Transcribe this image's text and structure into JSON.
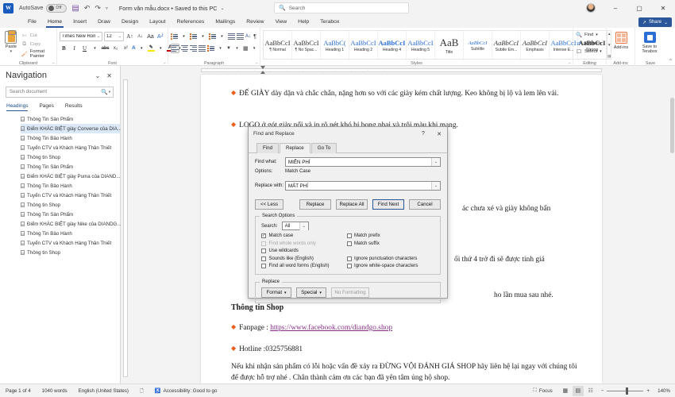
{
  "titlebar": {
    "app_icon": "word-logo",
    "autosave_label": "AutoSave",
    "autosave_state": "Off",
    "save_icon": "save-icon",
    "undo_icon": "undo-icon",
    "redo_icon": "redo-icon",
    "customize_icon": "customize-quick-access-icon",
    "document_title": "Form văn mẫu.docx  •  Saved to this PC",
    "title_caret": "⌄",
    "search_placeholder": "Search",
    "search_icon": "search-icon",
    "minimize": "–",
    "maximize": "▢",
    "close": "✕"
  },
  "tabs": [
    {
      "label": "File",
      "active": false
    },
    {
      "label": "Home",
      "active": true
    },
    {
      "label": "Insert",
      "active": false
    },
    {
      "label": "Draw",
      "active": false
    },
    {
      "label": "Design",
      "active": false
    },
    {
      "label": "Layout",
      "active": false
    },
    {
      "label": "References",
      "active": false
    },
    {
      "label": "Mailings",
      "active": false
    },
    {
      "label": "Review",
      "active": false
    },
    {
      "label": "View",
      "active": false
    },
    {
      "label": "Help",
      "active": false
    },
    {
      "label": "Terabox",
      "active": false
    }
  ],
  "share": {
    "label": "Share",
    "icon": "share-icon",
    "caret": "⌄"
  },
  "ribbon": {
    "clipboard": {
      "group_label": "Clipboard",
      "paste_label": "Paste",
      "paste_caret": "▾",
      "cut_label": "Cut",
      "copy_label": "Copy",
      "format_painter_label": "Format Painter",
      "launcher": "⌐"
    },
    "font": {
      "group_label": "Font",
      "font_name": "Times New Roman",
      "font_size": "12",
      "grow_font": "A",
      "shrink_font": "A",
      "change_case": "Aa",
      "clear_formatting": "A",
      "bold": "B",
      "italic": "I",
      "underline": "U",
      "strikethrough": "abc",
      "subscript": "x₂",
      "superscript": "x²",
      "text_color": "A",
      "highlight": "ab",
      "font_color_label": "A",
      "launcher": "⌐"
    },
    "paragraph": {
      "group_label": "Paragraph",
      "launcher": "⌐",
      "buttons": [
        "bullets",
        "numbering",
        "multilevel-list",
        "decrease-indent",
        "increase-indent",
        "sort",
        "show-marks",
        "align-left",
        "align-center",
        "align-right",
        "justify",
        "line-spacing",
        "shading",
        "borders"
      ]
    },
    "styles": {
      "group_label": "Styles",
      "launcher": "⌐",
      "items": [
        {
          "preview": "AaBbCcI",
          "name": "¶ Normal"
        },
        {
          "preview": "AaBbCcI",
          "name": "¶ No Spac..."
        },
        {
          "preview": "AaBbC(",
          "name": "Heading 1"
        },
        {
          "preview": "AaBbCcI",
          "name": "Heading 2"
        },
        {
          "preview": "AaBbCcI",
          "name": "Heading 4"
        },
        {
          "preview": "AaBbCcI",
          "name": "Heading 5"
        },
        {
          "preview": "AaB",
          "name": "Title"
        },
        {
          "preview": "AaBbCcI",
          "name": "Subtitle"
        },
        {
          "preview": "AaBbCcI",
          "name": "Subtle Em..."
        },
        {
          "preview": "AaBbCcI",
          "name": "Emphasis"
        },
        {
          "preview": "AaBbCcI",
          "name": "Intense E..."
        },
        {
          "preview": "AaBbCcI",
          "name": "Strong"
        }
      ]
    },
    "editing": {
      "group_label": "Editing",
      "find_label": "Find",
      "find_caret": "▾",
      "replace_label": "Replace",
      "select_label": "Select",
      "select_caret": "▾"
    },
    "addins": {
      "group_label": "Add-ins",
      "button_label": "Add-ins"
    },
    "save": {
      "group_label": "Save",
      "button_label": "Save to Terabox"
    },
    "collapse_icon": "chevron-up-icon"
  },
  "navigation": {
    "title": "Navigation",
    "collapse_icon": "chevron-down-icon",
    "close_icon": "close-icon",
    "search_placeholder": "Search document",
    "search_icon": "search-icon",
    "search_caret": "▾",
    "tabs": [
      {
        "label": "Headings",
        "active": true
      },
      {
        "label": "Pages",
        "active": false
      },
      {
        "label": "Results",
        "active": false
      }
    ],
    "headings": [
      {
        "label": "Thông Tin Sản Phẩm",
        "selected": false
      },
      {
        "label": "Điểm KHÁC BIỆT giày Converse của DIA...",
        "selected": true
      },
      {
        "label": "Thông Tin Bảo Hành",
        "selected": false
      },
      {
        "label": "Tuyển CTV và Khách Hàng Thân Thiết",
        "selected": false
      },
      {
        "label": "Thông tin Shop",
        "selected": false
      },
      {
        "label": "Thông Tin Sản Phẩm",
        "selected": false
      },
      {
        "label": "Điểm KHÁC BIỆT giày Puma của DIAND...",
        "selected": false
      },
      {
        "label": "Thông Tin Bảo Hành",
        "selected": false
      },
      {
        "label": "Tuyển CTV và Khách Hàng Thân Thiết",
        "selected": false
      },
      {
        "label": "Thông tin Shop",
        "selected": false
      },
      {
        "label": "Thông Tin Sản Phẩm",
        "selected": false
      },
      {
        "label": "Điểm KHÁC BIỆT giày Nike của DIANDG...",
        "selected": false
      },
      {
        "label": "Thông Tin Bảo Hành",
        "selected": false
      },
      {
        "label": "Tuyển CTV và Khách Hàng Thân Thiết",
        "selected": false
      },
      {
        "label": "Thông tin Shop",
        "selected": false
      }
    ]
  },
  "document": {
    "bullet_glyph": "◆",
    "para1": "ĐẾ GIÀY dày dặn và chắc chắn, nặng hơn so với các giày kém chất lượng. Keo không bị lộ và lem lên vải.",
    "para2": "LOGO ở gót giày nổi và in rõ nét khó bị bong phai và trôi màu khi mang.",
    "para3_tail": "ác chưa xé và giày không bẩn",
    "para4_tail": "ối thứ 4 trở đi sẽ được tính giá",
    "para5_tail": "ho lần mua sau nhé.",
    "heading_shop": "Thông tin Shop",
    "fanpage_label": "Fanpage : ",
    "fanpage_url": "https://www.facebook.com/diandgo.shop",
    "hotline": "Hotline :0325756881",
    "closing": "Nếu khi nhận sản phẩm có lỗi hoặc vấn đề xảy ra ĐỪNG VỘI ĐÁNH GIÁ SHOP hãy liên hệ lại ngay với chúng tôi để được hỗ trợ nhé . Chân thành cảm ơn các bạn đã yên tâm ủng hộ shop."
  },
  "dialog": {
    "title": "Find and Replace",
    "help_btn": "?",
    "close_btn": "✕",
    "tabs": [
      {
        "label": "Find",
        "active": false
      },
      {
        "label": "Replace",
        "active": true
      },
      {
        "label": "Go To",
        "active": false
      }
    ],
    "find_what_label": "Find what:",
    "find_what_value": "MIỄN PHÍ",
    "options_label": "Options:",
    "options_value": "Match Case",
    "replace_with_label": "Replace with:",
    "replace_with_value": "MẤT PHÍ",
    "dropdown_caret": "⌄",
    "less_btn": "<< Less",
    "replace_btn": "Replace",
    "replace_all_btn": "Replace All",
    "find_next_btn": "Find Next",
    "cancel_btn": "Cancel",
    "search_options_legend": "Search Options",
    "search_label": "Search:",
    "search_value": "All",
    "checkboxes_left": [
      {
        "label": "Match case",
        "checked": true,
        "disabled": false
      },
      {
        "label": "Find whole words only",
        "checked": false,
        "disabled": true
      },
      {
        "label": "Use wildcards",
        "checked": false,
        "disabled": false
      },
      {
        "label": "Sounds like (English)",
        "checked": false,
        "disabled": false
      },
      {
        "label": "Find all word forms (English)",
        "checked": false,
        "disabled": false
      }
    ],
    "checkboxes_right": [
      {
        "label": "Match prefix",
        "checked": false,
        "disabled": false
      },
      {
        "label": "Match suffix",
        "checked": false,
        "disabled": false
      },
      {
        "label": "",
        "checked": false,
        "disabled": false,
        "spacer": true
      },
      {
        "label": "Ignore punctuation characters",
        "checked": false,
        "disabled": false
      },
      {
        "label": "Ignore white-space characters",
        "checked": false,
        "disabled": false
      }
    ],
    "replace_legend": "Replace",
    "format_btn": "Format",
    "special_btn": "Special",
    "no_formatting_btn": "No Formatting",
    "btn_caret": "▾"
  },
  "statusbar": {
    "page": "Page 1 of 4",
    "words": "1040 words",
    "language": "English (United States)",
    "proofing_icon": "proofing-errors-icon",
    "accessibility": "Accessibility: Good to go",
    "accessibility_icon": "accessibility-icon",
    "focus": "Focus",
    "focus_icon": "focus-icon",
    "view_read": "read-mode-icon",
    "view_print": "print-layout-icon",
    "view_web": "web-layout-icon",
    "zoom_out": "−",
    "zoom_in": "+",
    "zoom_value": "140%"
  }
}
